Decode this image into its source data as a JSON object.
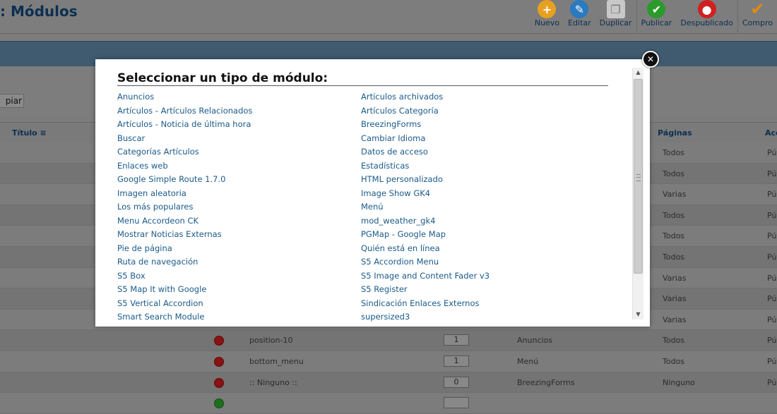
{
  "page": {
    "title": ": Módulos"
  },
  "toolbar": {
    "buttons": [
      {
        "label": "Nuevo",
        "icon": "plus-icon",
        "color": "#e8a020"
      },
      {
        "label": "Editar",
        "icon": "edit-icon",
        "color": "#2a7ac0"
      },
      {
        "label": "Duplicar",
        "icon": "copy-icon",
        "color": "#c8c8c8"
      },
      {
        "label": "Publicar",
        "icon": "check-icon",
        "color": "#2a9a2a"
      },
      {
        "label": "Despublicado",
        "icon": "unpublish-icon",
        "color": "#d02020"
      },
      {
        "label": "Compro",
        "icon": "checkin-icon",
        "color": "#e08a10"
      }
    ]
  },
  "filter": {
    "clear_label": "piar"
  },
  "table": {
    "headers": {
      "title": "Título",
      "pages": "Páginas",
      "access": "Acc"
    },
    "rows": [
      {
        "pages": "Todos",
        "access": "Pú"
      },
      {
        "pages": "Todos",
        "access": "Pú"
      },
      {
        "pages": "Varias",
        "access": "Pú"
      },
      {
        "pages": "Todos",
        "access": "Pú"
      },
      {
        "pages": "Todos",
        "access": "Pú"
      },
      {
        "pages": "Todos",
        "access": "Pú"
      },
      {
        "pages": "Varias",
        "access": "Pú"
      },
      {
        "pages": "Varias",
        "access": "Pú"
      },
      {
        "pages": "Varias",
        "access": "Pú"
      },
      {
        "position": "position-10",
        "order": "1",
        "type": "Anuncios",
        "pages": "Todos",
        "access": "Pú"
      },
      {
        "position": "bottom_menu",
        "order": "1",
        "type": "Menú",
        "pages": "Todos",
        "access": "Pú"
      },
      {
        "position": ":: Ninguno ::",
        "order": "0",
        "type": "BreezingForms",
        "pages": "Ninguno",
        "access": "Pú"
      }
    ]
  },
  "modal": {
    "title": "Seleccionar un tipo de módulo:",
    "left_items": [
      "Anuncios",
      "Artículos - Artículos Relacionados",
      "Artículos - Noticia de última hora",
      "Buscar",
      "Categorías Artículos",
      "Enlaces web",
      "Google Simple Route 1.7.0",
      "Imagen aleatoria",
      "Los más populares",
      "Menu Accordeon CK",
      "Mostrar Noticias Externas",
      "Pie de página",
      "Ruta de navegación",
      "S5 Box",
      "S5 Map It with Google",
      "S5 Vertical Accordion",
      "Smart Search Module"
    ],
    "right_items": [
      "Artículos archivados",
      "Artículos Categoría",
      "BreezingForms",
      "Cambiar Idioma",
      "Datos de acceso",
      "Estadísticas",
      "HTML personalizado",
      "Image Show GK4",
      "Menú",
      "mod_weather_gk4",
      "PGMap - Google Map",
      "Quién está en línea",
      "S5 Accordion Menu",
      "S5 Image and Content Fader v3",
      "S5 Register",
      "Sindicación Enlaces Externos",
      "supersized3"
    ]
  }
}
